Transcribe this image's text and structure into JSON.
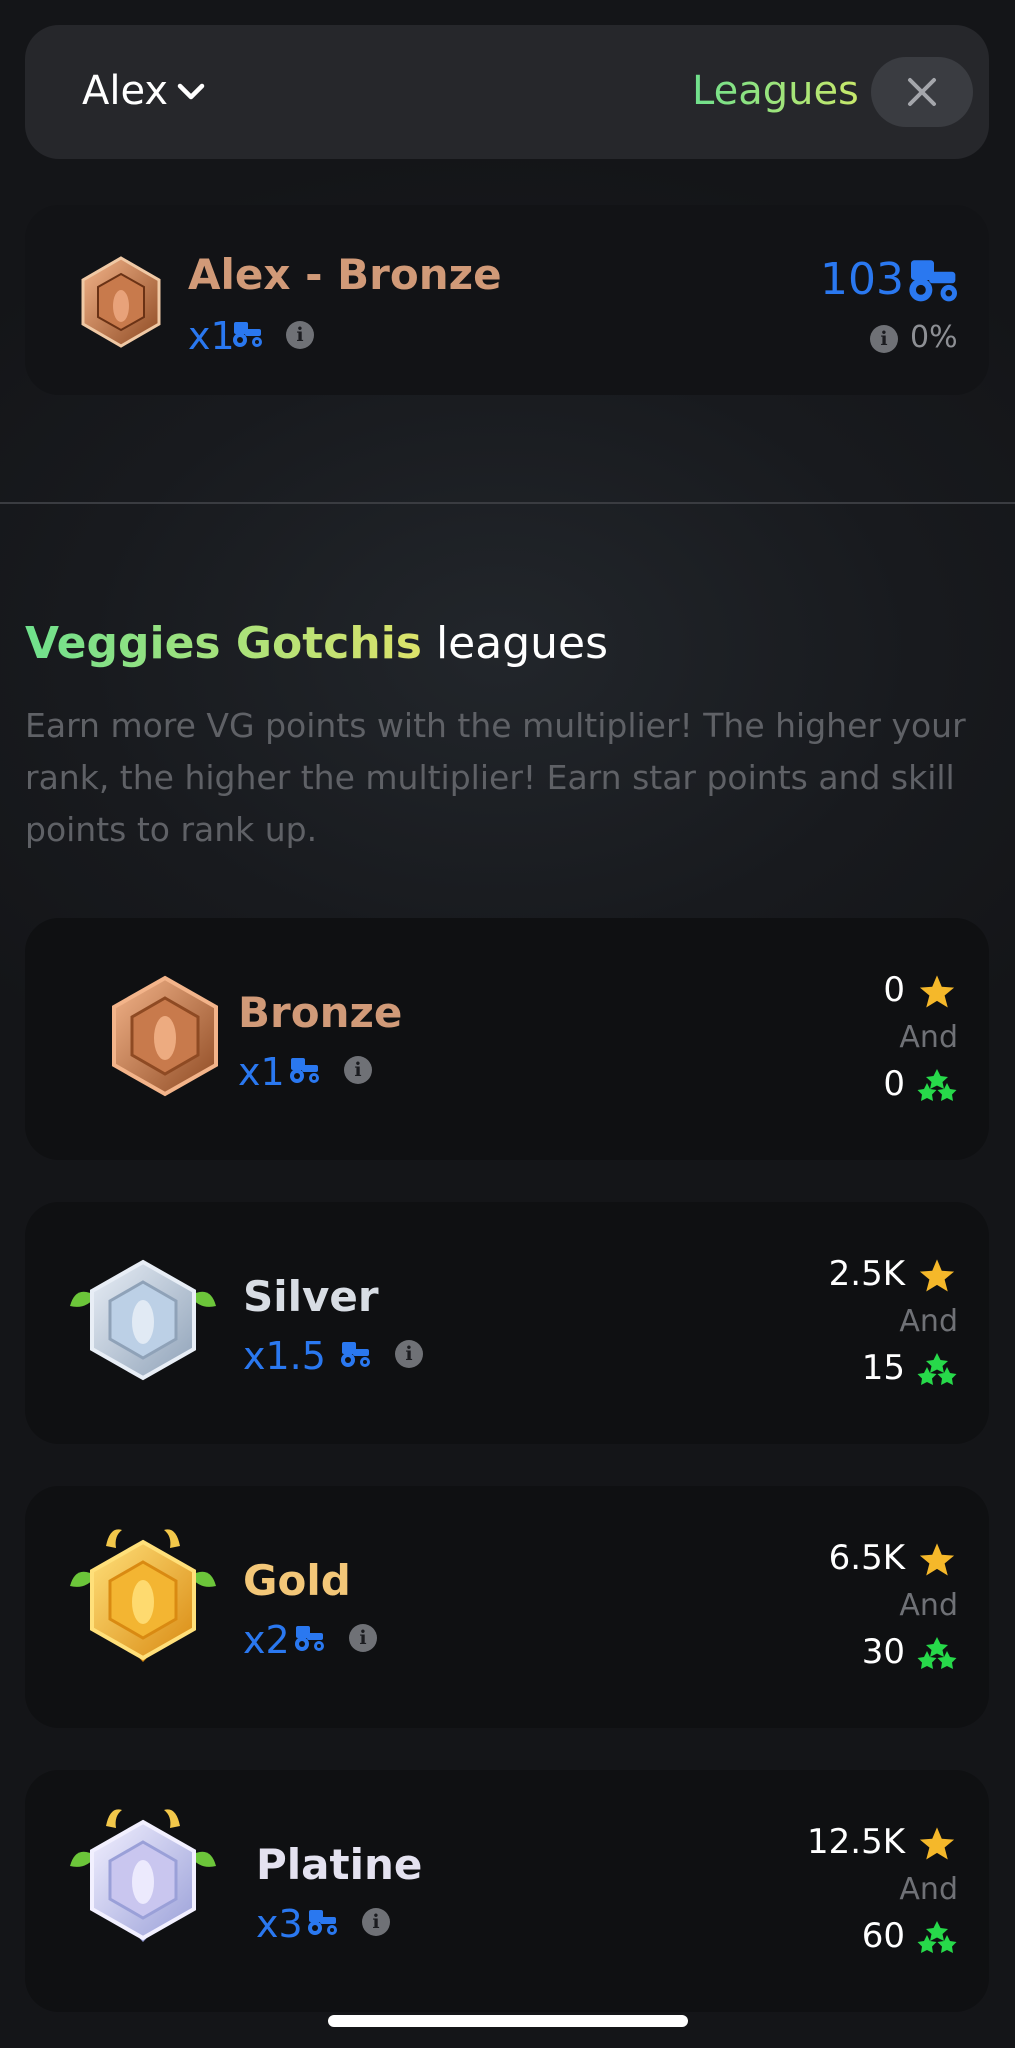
{
  "header": {
    "user_name": "Alex",
    "title": "Leagues"
  },
  "current": {
    "name": "Alex - Bronze",
    "multiplier": "x1",
    "points": "103",
    "progress": "0%"
  },
  "section": {
    "title_highlight": "Veggies Gotchis",
    "title_rest": " leagues",
    "description": "Earn more VG points with the multiplier! The higher your rank, the higher the multiplier! Earn star points and skill points to rank up."
  },
  "leagues": [
    {
      "name": "Bronze",
      "multiplier": "x1",
      "stars": "0",
      "and": "And",
      "skill": "0",
      "color": "#d19a78"
    },
    {
      "name": "Silver",
      "multiplier": "x1.5",
      "stars": "2.5K",
      "and": "And",
      "skill": "15",
      "color": "#d8dde4"
    },
    {
      "name": "Gold",
      "multiplier": "x2",
      "stars": "6.5K",
      "and": "And",
      "skill": "30",
      "color": "#f3c778"
    },
    {
      "name": "Platine",
      "multiplier": "x3",
      "stars": "12.5K",
      "and": "And",
      "skill": "60",
      "color": "#e4e2f0"
    }
  ],
  "colors": {
    "accent_blue": "#2a78f0",
    "star": "#f5b82a",
    "skill": "#27d94a"
  }
}
